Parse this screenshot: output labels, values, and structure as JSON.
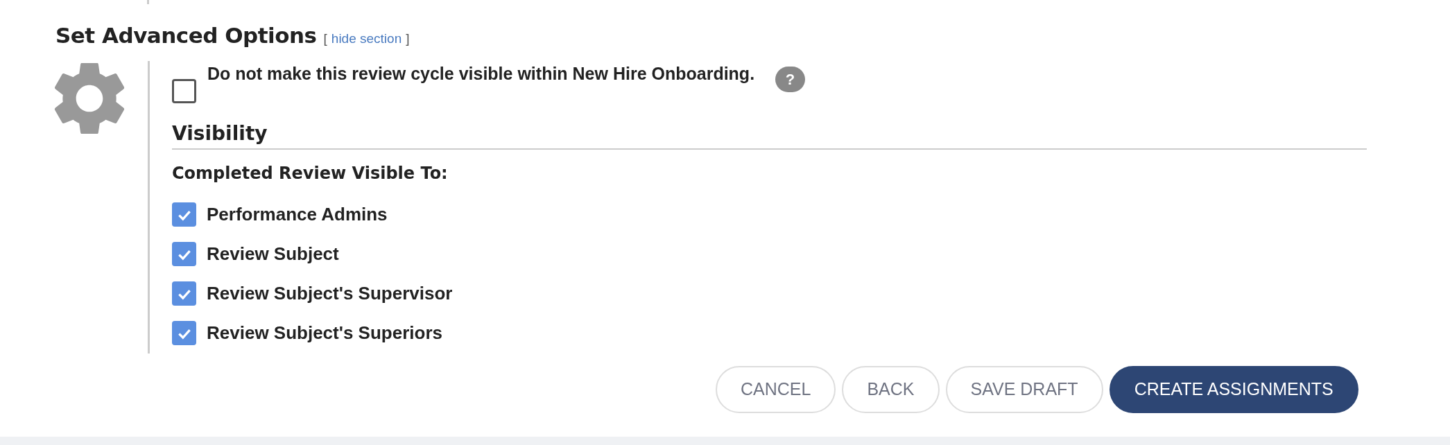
{
  "section": {
    "title": "Set Advanced Options",
    "bracket_open": "[",
    "hide_link": "hide section",
    "bracket_close": "]"
  },
  "hide_option": {
    "label": "Do not make this review cycle visible within New Hire Onboarding.",
    "checked": false,
    "help": "?"
  },
  "visibility": {
    "heading": "Visibility",
    "subheading": "Completed Review Visible To:",
    "options": [
      {
        "label": "Performance Admins",
        "checked": true
      },
      {
        "label": "Review Subject",
        "checked": true
      },
      {
        "label": "Review Subject's Supervisor",
        "checked": true
      },
      {
        "label": "Review Subject's Superiors",
        "checked": true
      }
    ]
  },
  "buttons": [
    {
      "label": "CANCEL",
      "kind": "secondary"
    },
    {
      "label": "BACK",
      "kind": "secondary"
    },
    {
      "label": "SAVE DRAFT",
      "kind": "secondary"
    },
    {
      "label": "CREATE ASSIGNMENTS",
      "kind": "primary"
    }
  ]
}
